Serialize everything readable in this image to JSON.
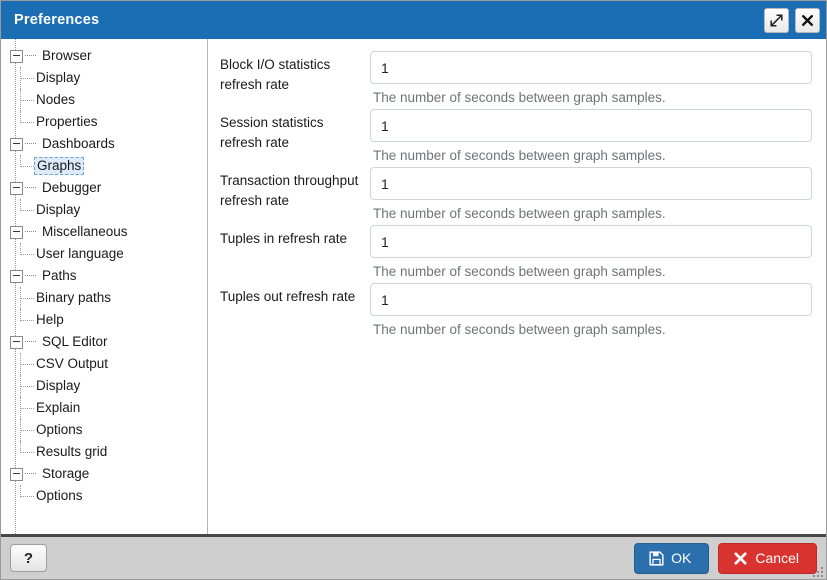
{
  "window": {
    "title": "Preferences",
    "accent_color": "#1b6eb4",
    "controls": [
      {
        "name": "maximize-button",
        "icon": "expand-diagonal-icon"
      },
      {
        "name": "close-button",
        "icon": "close-icon"
      }
    ]
  },
  "tree": {
    "selected": "Graphs",
    "items": [
      {
        "label": "Browser",
        "level": 0,
        "expanded": true,
        "last_child": false
      },
      {
        "label": "Display",
        "level": 1,
        "expanded": false,
        "last_child": false
      },
      {
        "label": "Nodes",
        "level": 1,
        "expanded": false,
        "last_child": false
      },
      {
        "label": "Properties",
        "level": 1,
        "expanded": false,
        "last_child": true
      },
      {
        "label": "Dashboards",
        "level": 0,
        "expanded": true,
        "last_child": false
      },
      {
        "label": "Graphs",
        "level": 1,
        "expanded": false,
        "last_child": true
      },
      {
        "label": "Debugger",
        "level": 0,
        "expanded": true,
        "last_child": false
      },
      {
        "label": "Display",
        "level": 1,
        "expanded": false,
        "last_child": true
      },
      {
        "label": "Miscellaneous",
        "level": 0,
        "expanded": true,
        "last_child": false
      },
      {
        "label": "User language",
        "level": 1,
        "expanded": false,
        "last_child": true
      },
      {
        "label": "Paths",
        "level": 0,
        "expanded": true,
        "last_child": false
      },
      {
        "label": "Binary paths",
        "level": 1,
        "expanded": false,
        "last_child": false
      },
      {
        "label": "Help",
        "level": 1,
        "expanded": false,
        "last_child": true
      },
      {
        "label": "SQL Editor",
        "level": 0,
        "expanded": true,
        "last_child": false
      },
      {
        "label": "CSV Output",
        "level": 1,
        "expanded": false,
        "last_child": false
      },
      {
        "label": "Display",
        "level": 1,
        "expanded": false,
        "last_child": false
      },
      {
        "label": "Explain",
        "level": 1,
        "expanded": false,
        "last_child": false
      },
      {
        "label": "Options",
        "level": 1,
        "expanded": false,
        "last_child": false
      },
      {
        "label": "Results grid",
        "level": 1,
        "expanded": false,
        "last_child": true
      },
      {
        "label": "Storage",
        "level": 0,
        "expanded": true,
        "last_child": true
      },
      {
        "label": "Options",
        "level": 1,
        "expanded": false,
        "last_child": true
      }
    ]
  },
  "form": {
    "fields": [
      {
        "label": "Block I/O statistics refresh rate",
        "value": "1",
        "help": "The number of seconds between graph samples."
      },
      {
        "label": "Session statistics refresh rate",
        "value": "1",
        "help": "The number of seconds between graph samples."
      },
      {
        "label": "Transaction throughput refresh rate",
        "value": "1",
        "help": "The number of seconds between graph samples."
      },
      {
        "label": "Tuples in refresh rate",
        "value": "1",
        "help": "The number of seconds between graph samples."
      },
      {
        "label": "Tuples out refresh rate",
        "value": "1",
        "help": "The number of seconds between graph samples."
      }
    ]
  },
  "footer": {
    "help_label": "?",
    "ok_label": "OK",
    "ok_icon": "save-floppy-icon",
    "ok_color": "#2b6fad",
    "cancel_label": "Cancel",
    "cancel_icon": "close-x-icon",
    "cancel_color": "#d9332f"
  }
}
